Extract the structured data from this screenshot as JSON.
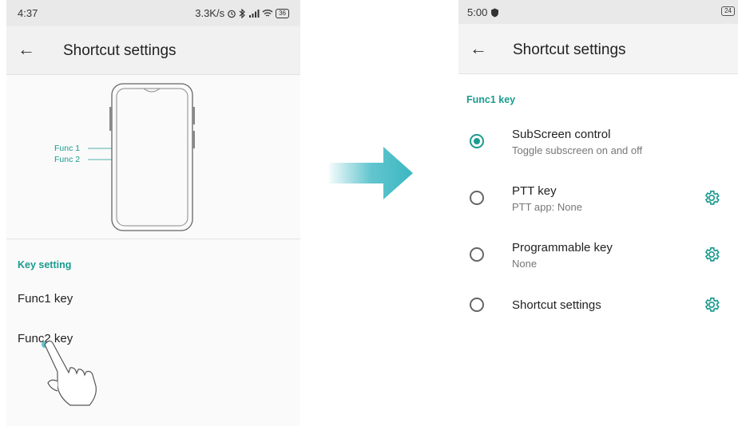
{
  "left_screen": {
    "status": {
      "time": "4:37",
      "right": "3.3K/s",
      "battery": "36"
    },
    "appbar": {
      "title": "Shortcut settings"
    },
    "diagram": {
      "func1": "Func 1",
      "func2": "Func 2"
    },
    "section_label": "Key setting",
    "items": [
      "Func1 key",
      "Func2 key"
    ]
  },
  "right_screen": {
    "status": {
      "time": "5:00",
      "battery": "24"
    },
    "appbar": {
      "title": "Shortcut settings"
    },
    "section_label": "Func1 key",
    "options": [
      {
        "title": "SubScreen control",
        "subtitle": "Toggle subscreen on and off",
        "selected": true,
        "gear": false
      },
      {
        "title": "PTT key",
        "subtitle": "PTT app: None",
        "selected": false,
        "gear": true
      },
      {
        "title": "Programmable key",
        "subtitle": "None",
        "selected": false,
        "gear": true
      },
      {
        "title": "Shortcut settings",
        "subtitle": "",
        "selected": false,
        "gear": true
      }
    ]
  },
  "colors": {
    "accent": "#1a9b8f",
    "arrow": "#3bb7c2",
    "statusbar": "#e9e9e9"
  },
  "icons": [
    "back-arrow-icon",
    "gear-icon",
    "hand-pointer-icon",
    "shield-icon",
    "alarm-icon",
    "bluetooth-icon",
    "signal-icon",
    "wifi-icon",
    "battery-icon"
  ]
}
